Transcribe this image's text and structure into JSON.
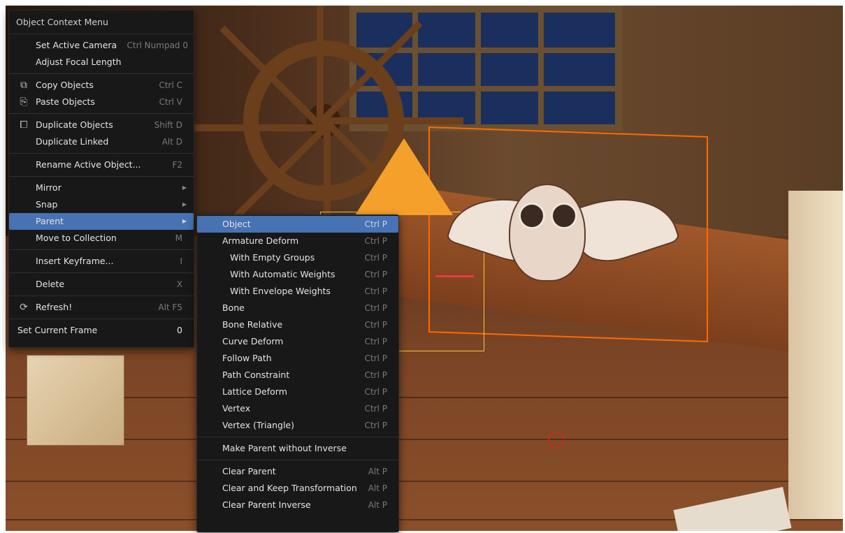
{
  "context_menu": {
    "title": "Object Context Menu",
    "set_active_camera": {
      "label": "Set Active Camera",
      "shortcut": "Ctrl Numpad 0"
    },
    "adjust_focal_length": {
      "label": "Adjust Focal Length"
    },
    "copy_objects": {
      "label": "Copy Objects",
      "shortcut": "Ctrl C",
      "icon": "copy-icon"
    },
    "paste_objects": {
      "label": "Paste Objects",
      "shortcut": "Ctrl V",
      "icon": "paste-icon"
    },
    "duplicate_objects": {
      "label": "Duplicate Objects",
      "shortcut": "Shift D",
      "icon": "duplicate-icon"
    },
    "duplicate_linked": {
      "label": "Duplicate Linked",
      "shortcut": "Alt D"
    },
    "rename_active_object": {
      "label": "Rename Active Object...",
      "shortcut": "F2"
    },
    "mirror": {
      "label": "Mirror"
    },
    "snap": {
      "label": "Snap"
    },
    "parent": {
      "label": "Parent"
    },
    "move_to_collection": {
      "label": "Move to Collection",
      "shortcut": "M"
    },
    "insert_keyframe": {
      "label": "Insert Keyframe...",
      "shortcut": "I"
    },
    "delete": {
      "label": "Delete",
      "shortcut": "X"
    },
    "refresh": {
      "label": "Refresh!",
      "shortcut": "Alt F5",
      "icon": "refresh-icon"
    },
    "set_current_frame": {
      "label": "Set Current Frame",
      "value": "0"
    }
  },
  "parent_submenu": {
    "object": {
      "label": "Object",
      "shortcut": "Ctrl P"
    },
    "armature_deform": {
      "label": "Armature Deform",
      "shortcut": "Ctrl P"
    },
    "with_empty_groups": {
      "label": "With Empty Groups",
      "shortcut": "Ctrl P"
    },
    "with_automatic_weights": {
      "label": "With Automatic Weights",
      "shortcut": "Ctrl P"
    },
    "with_envelope_weights": {
      "label": "With Envelope Weights",
      "shortcut": "Ctrl P"
    },
    "bone": {
      "label": "Bone",
      "shortcut": "Ctrl P"
    },
    "bone_relative": {
      "label": "Bone Relative",
      "shortcut": "Ctrl P"
    },
    "curve_deform": {
      "label": "Curve Deform",
      "shortcut": "Ctrl P"
    },
    "follow_path": {
      "label": "Follow Path",
      "shortcut": "Ctrl P"
    },
    "path_constraint": {
      "label": "Path Constraint",
      "shortcut": "Ctrl P"
    },
    "lattice_deform": {
      "label": "Lattice Deform",
      "shortcut": "Ctrl P"
    },
    "vertex": {
      "label": "Vertex",
      "shortcut": "Ctrl P"
    },
    "vertex_triangle": {
      "label": "Vertex (Triangle)",
      "shortcut": "Ctrl P"
    },
    "make_parent_without_inverse": {
      "label": "Make Parent without Inverse"
    },
    "clear_parent": {
      "label": "Clear Parent",
      "shortcut": "Alt P"
    },
    "clear_and_keep_transformation": {
      "label": "Clear and Keep Transformation",
      "shortcut": "Alt P"
    },
    "clear_parent_inverse": {
      "label": "Clear Parent Inverse",
      "shortcut": "Alt P"
    }
  },
  "colors": {
    "menu_bg": "#181818",
    "highlight": "#4772b3",
    "text": "#e4e4e4",
    "shortcut_text": "#7a7a7a",
    "selection_outline": "#ff6a00",
    "camera_gizmo": "#f5a02a"
  }
}
